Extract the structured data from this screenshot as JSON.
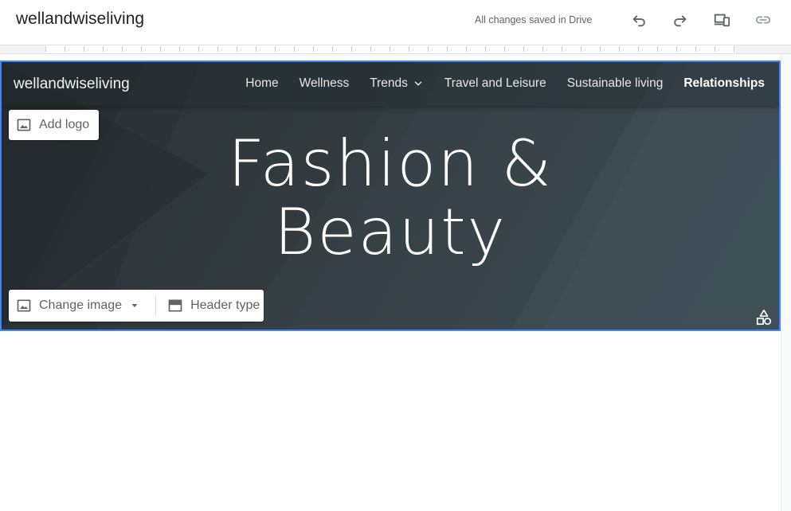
{
  "appbar": {
    "site_title": "wellandwiseliving",
    "save_status": "All changes saved in Drive",
    "icons": [
      "undo-icon",
      "redo-icon",
      "preview-devices-icon",
      "copy-link-icon"
    ]
  },
  "header": {
    "brand": "wellandwiseliving",
    "nav": [
      {
        "label": "Home"
      },
      {
        "label": "Wellness"
      },
      {
        "label": "Trends"
      },
      {
        "label": "Travel and Leisure"
      },
      {
        "label": "Sustainable living"
      },
      {
        "label": "Relationships",
        "active": true
      }
    ],
    "title_line1": "Fashion &",
    "title_line2": "Beauty",
    "add_logo": "Add logo",
    "change_image": "Change image",
    "header_type": "Header type"
  },
  "colors": {
    "accent": "#4285f4",
    "banner": "#343d42"
  }
}
